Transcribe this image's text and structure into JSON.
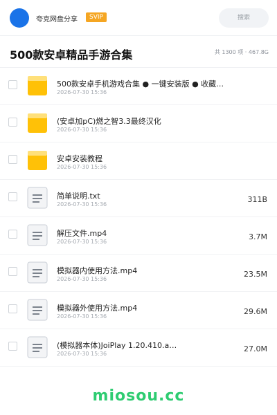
{
  "header": {
    "brand": "夸克网盘分享",
    "badge": "SVIP",
    "search_placeholder": "搜索"
  },
  "title": {
    "text": "500款安卓精品手游合集",
    "summary": "共 1300 项 · 467.8G"
  },
  "colors": {
    "accent": "#1a73e8",
    "svip": "#f5a623",
    "watermark": "#2ecc71",
    "folder": "#ffc107"
  },
  "items": [
    {
      "type": "folder",
      "icon": "folder-icon",
      "name": "500款安卓手机游戏合集 ● 一键安装版 ● 收藏…",
      "time": "2026-07-30 15:36",
      "size": ""
    },
    {
      "type": "folder",
      "icon": "folder-icon",
      "name": "(安卓加pC)燃之智3.3最终汉化",
      "time": "2026-07-30 15:36",
      "size": ""
    },
    {
      "type": "folder",
      "icon": "folder-icon",
      "name": "安卓安装教程",
      "time": "2026-07-30 15:36",
      "size": ""
    },
    {
      "type": "file",
      "icon": "document-icon",
      "name": "简单说明.txt",
      "time": "2026-07-30 15:36",
      "size": "311B"
    },
    {
      "type": "file",
      "icon": "document-icon",
      "name": "解压文件.mp4",
      "time": "2026-07-30 15:36",
      "size": "3.7M"
    },
    {
      "type": "file",
      "icon": "document-icon",
      "name": "模拟器内使用方法.mp4",
      "time": "2026-07-30 15:36",
      "size": "23.5M"
    },
    {
      "type": "file",
      "icon": "document-icon",
      "name": "模拟器外使用方法.mp4",
      "time": "2026-07-30 15:36",
      "size": "29.6M"
    },
    {
      "type": "file",
      "icon": "document-icon",
      "name": "(模拟器本体)JoiPlay 1.20.410.a…",
      "time": "2026-07-30 15:36",
      "size": "27.0M"
    }
  ],
  "watermark": "miosou.cc"
}
